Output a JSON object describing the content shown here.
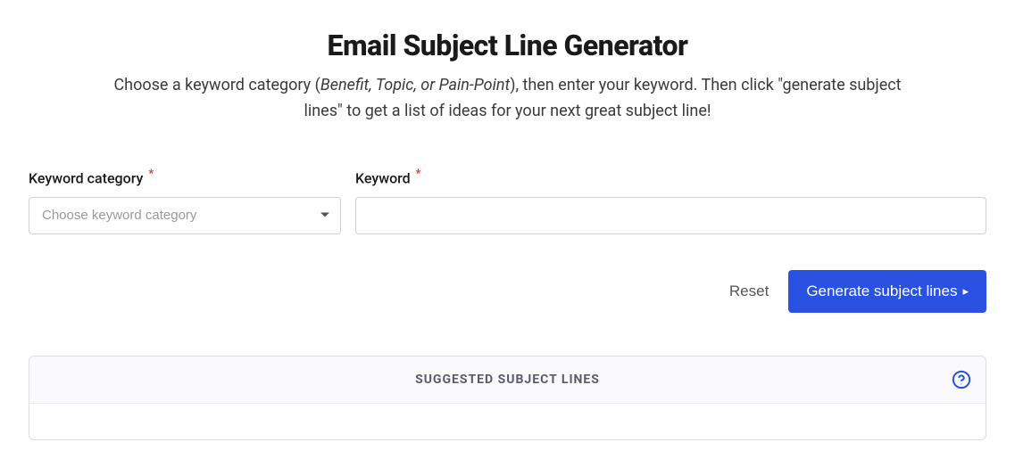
{
  "header": {
    "title": "Email Subject Line Generator",
    "subtitle_prefix": "Choose a keyword category (",
    "subtitle_italic": "Benefit, Topic, or Pain-Point",
    "subtitle_suffix": "), then enter your keyword. Then click \"generate subject lines\" to get a list of ideas for your next great subject line!"
  },
  "form": {
    "category": {
      "label": "Keyword category",
      "required_mark": "*",
      "placeholder": "Choose keyword category",
      "value": ""
    },
    "keyword": {
      "label": "Keyword",
      "required_mark": "*",
      "value": ""
    }
  },
  "actions": {
    "reset_label": "Reset",
    "generate_label": "Generate subject lines"
  },
  "results": {
    "heading": "SUGGESTED SUBJECT LINES"
  }
}
